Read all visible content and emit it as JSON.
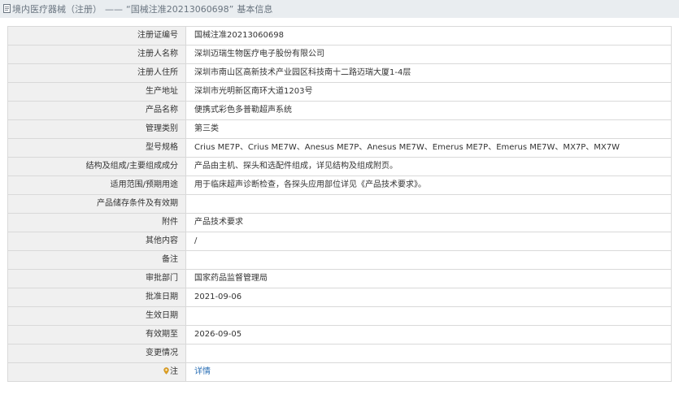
{
  "header": {
    "title": "境内医疗器械（注册）",
    "separator": "——",
    "quoted": "“国械注准20213060698”",
    "suffix": "基本信息"
  },
  "rows": [
    {
      "label": "注册证编号",
      "value": "国械注准20213060698"
    },
    {
      "label": "注册人名称",
      "value": "深圳迈瑞生物医疗电子股份有限公司"
    },
    {
      "label": "注册人住所",
      "value": "深圳市南山区高新技术产业园区科技南十二路迈瑞大厦1-4层"
    },
    {
      "label": "生产地址",
      "value": "深圳市光明新区南环大道1203号"
    },
    {
      "label": "产品名称",
      "value": "便携式彩色多普勒超声系统"
    },
    {
      "label": "管理类别",
      "value": "第三类"
    },
    {
      "label": "型号规格",
      "value": "Crius ME7P、Crius ME7W、Anesus ME7P、Anesus ME7W、Emerus ME7P、Emerus ME7W、MX7P、MX7W"
    },
    {
      "label": "结构及组成/主要组成成分",
      "value": "产品由主机、探头和选配件组成，详见结构及组成附页。"
    },
    {
      "label": "适用范围/预期用途",
      "value": "用于临床超声诊断检查，各探头应用部位详见《产品技术要求》。"
    },
    {
      "label": "产品储存条件及有效期",
      "value": ""
    },
    {
      "label": "附件",
      "value": "产品技术要求"
    },
    {
      "label": "其他内容",
      "value": "/"
    },
    {
      "label": "备注",
      "value": ""
    },
    {
      "label": "审批部门",
      "value": "国家药品监督管理局"
    },
    {
      "label": "批准日期",
      "value": "2021-09-06"
    },
    {
      "label": "生效日期",
      "value": ""
    },
    {
      "label": "有效期至",
      "value": "2026-09-05"
    },
    {
      "label": "变更情况",
      "value": ""
    }
  ],
  "note_row": {
    "label": "注",
    "icon": "location-pin-icon",
    "link": "详情"
  },
  "colors": {
    "header_bg": "#e9edf0",
    "label_bg": "#f0f0f0",
    "border": "#d9d9d9",
    "link": "#2a6fb5"
  }
}
